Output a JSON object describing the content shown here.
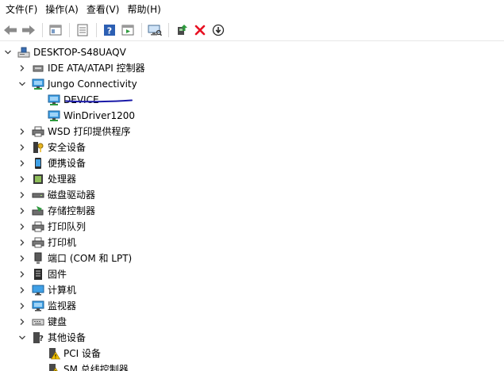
{
  "menu": {
    "file": "文件(F)",
    "action": "操作(A)",
    "view": "查看(V)",
    "help": "帮助(H)"
  },
  "toolbar": {
    "icons": [
      "back-arrow-icon",
      "forward-arrow-icon",
      "show-hide-console-tree-icon",
      "properties-icon",
      "help-icon",
      "action-pane-icon",
      "scan-hardware-icon",
      "update-driver-icon",
      "uninstall-device-icon",
      "disable-device-icon"
    ]
  },
  "tree": {
    "root": "DESKTOP-S48UAQV",
    "items": [
      {
        "label": "IDE ATA/ATAPI 控制器",
        "icon": "ide-controller-icon",
        "state": "collapsed"
      },
      {
        "label": "Jungo Connectivity",
        "icon": "network-adapter-icon",
        "state": "expanded"
      },
      {
        "label": "DEVICE",
        "icon": "network-adapter-icon",
        "state": "leaf"
      },
      {
        "label": "WinDriver1200",
        "icon": "network-adapter-icon",
        "state": "leaf"
      },
      {
        "label": "WSD 打印提供程序",
        "icon": "printer-icon",
        "state": "collapsed"
      },
      {
        "label": "安全设备",
        "icon": "security-key-icon",
        "state": "collapsed"
      },
      {
        "label": "便携设备",
        "icon": "portable-device-icon",
        "state": "collapsed"
      },
      {
        "label": "处理器",
        "icon": "processor-icon",
        "state": "collapsed"
      },
      {
        "label": "磁盘驱动器",
        "icon": "disk-drive-icon",
        "state": "collapsed"
      },
      {
        "label": "存储控制器",
        "icon": "storage-controller-icon",
        "state": "collapsed"
      },
      {
        "label": "打印队列",
        "icon": "printer-icon",
        "state": "collapsed"
      },
      {
        "label": "打印机",
        "icon": "printer-icon",
        "state": "collapsed"
      },
      {
        "label": "端口 (COM 和 LPT)",
        "icon": "port-icon",
        "state": "collapsed"
      },
      {
        "label": "固件",
        "icon": "firmware-icon",
        "state": "collapsed"
      },
      {
        "label": "计算机",
        "icon": "computer-icon",
        "state": "collapsed"
      },
      {
        "label": "监视器",
        "icon": "monitor-icon",
        "state": "collapsed"
      },
      {
        "label": "键盘",
        "icon": "keyboard-icon",
        "state": "collapsed"
      },
      {
        "label": "其他设备",
        "icon": "unknown-device-icon",
        "state": "expanded"
      },
      {
        "label": "PCI 设备",
        "icon": "warning-device-icon",
        "state": "leaf"
      },
      {
        "label": "SM 总线控制器",
        "icon": "warning-device-icon",
        "state": "leaf"
      }
    ]
  },
  "colors": {
    "annotation_stroke": "#1a1aa8",
    "icon_blue": "#1f7fd6",
    "uninstall_red": "#e81123"
  }
}
